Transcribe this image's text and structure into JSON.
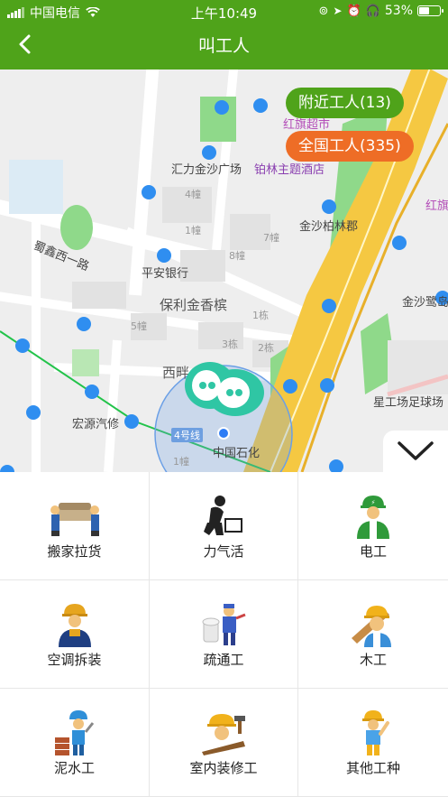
{
  "status_bar": {
    "carrier": "中国电信",
    "time": "上午10:49",
    "battery": "53%",
    "battery_level": 0.53
  },
  "nav": {
    "title": "叫工人"
  },
  "map": {
    "nearby_button": "附近工人(13)",
    "nationwide_button": "全国工人(335)",
    "labels": [
      "红旗超市",
      "汇力金沙广场",
      "铂林主题酒店",
      "4幢",
      "1幢",
      "7幢",
      "8幢",
      "金沙柏林郡",
      "蜀鑫西一路",
      "平安银行",
      "保利金香槟",
      "5幢",
      "1栋",
      "3栋",
      "2栋",
      "西畔",
      "星工场足球场",
      "宏源汽修",
      "4号线",
      "中国石化",
      "1幢",
      "金沙鹭岛",
      "红旗",
      "红旗连锁(金沙鹭岛店)"
    ]
  },
  "categories": [
    {
      "label": "搬家拉货",
      "icon": "moving-workers-icon"
    },
    {
      "label": "力气活",
      "icon": "laborer-icon"
    },
    {
      "label": "电工",
      "icon": "electrician-icon"
    },
    {
      "label": "空调拆装",
      "icon": "ac-installer-icon"
    },
    {
      "label": "疏通工",
      "icon": "plumber-icon"
    },
    {
      "label": "木工",
      "icon": "carpenter-icon"
    },
    {
      "label": "泥水工",
      "icon": "mason-icon"
    },
    {
      "label": "室内装修工",
      "icon": "decorator-icon"
    },
    {
      "label": "其他工种",
      "icon": "other-worker-icon"
    }
  ],
  "colors": {
    "brand_green": "#4fa31a",
    "accent_orange": "#ee6d26",
    "road_yellow": "#f5c842",
    "park_green": "#8fd98a"
  }
}
